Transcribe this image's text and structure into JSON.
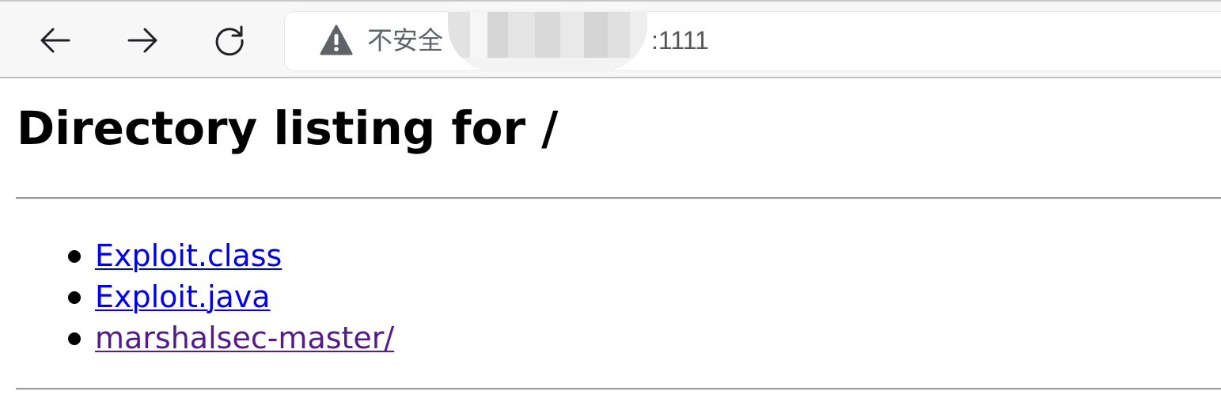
{
  "browser": {
    "nav": {
      "back_icon": "arrow-left-icon",
      "forward_icon": "arrow-right-icon",
      "reload_icon": "reload-icon"
    },
    "address_bar": {
      "security_icon": "warning-triangle-icon",
      "security_label": "不安全",
      "url_host_redacted": true,
      "url_port": ":1111"
    }
  },
  "page": {
    "title": "Directory listing for /",
    "entries": [
      {
        "label": "Exploit.class",
        "visited": false
      },
      {
        "label": "Exploit.java",
        "visited": false
      },
      {
        "label": "marshalsec-master/",
        "visited": true
      }
    ]
  },
  "colors": {
    "link": "#0000ee",
    "link_visited": "#551a8b",
    "toolbar_bg": "#f7f7f7",
    "security_text": "#5f6368"
  }
}
